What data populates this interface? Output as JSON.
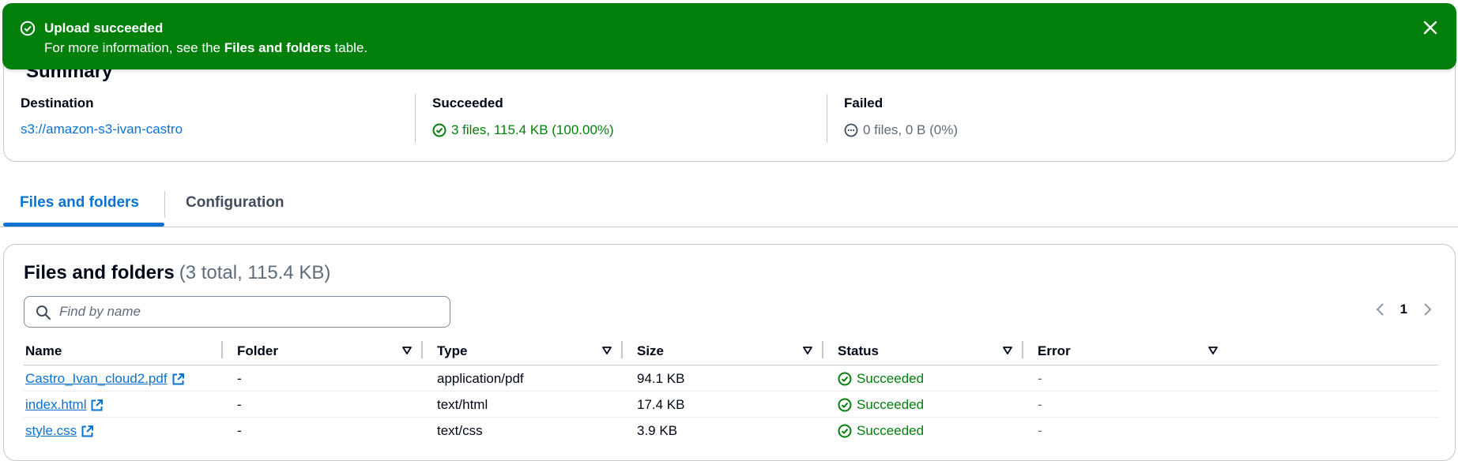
{
  "flash": {
    "title": "Upload succeeded",
    "message_prefix": "For more information, see the ",
    "message_bold": "Files and folders",
    "message_suffix": " table.",
    "color": "#037f0c"
  },
  "summary": {
    "title": "Summary",
    "destination": {
      "label": "Destination",
      "value": "s3://amazon-s3-ivan-castro"
    },
    "succeeded": {
      "label": "Succeeded",
      "value": "3 files, 115.4 KB (100.00%)"
    },
    "failed": {
      "label": "Failed",
      "value": "0 files, 0 B (0%)"
    }
  },
  "tabs": [
    {
      "label": "Files and folders",
      "active": true
    },
    {
      "label": "Configuration",
      "active": false
    }
  ],
  "files": {
    "title": "Files and folders",
    "count": "(3 total, 115.4 KB)",
    "search_placeholder": "Find by name",
    "page": "1",
    "columns": [
      "Name",
      "Folder",
      "Type",
      "Size",
      "Status",
      "Error"
    ],
    "rows": [
      {
        "name": "Castro_Ivan_cloud2.pdf",
        "folder": "-",
        "type": "application/pdf",
        "size": "94.1 KB",
        "status": "Succeeded",
        "error": "-"
      },
      {
        "name": "index.html",
        "folder": "-",
        "type": "text/html",
        "size": "17.4 KB",
        "status": "Succeeded",
        "error": "-"
      },
      {
        "name": "style.css",
        "folder": "-",
        "type": "text/css",
        "size": "3.9 KB",
        "status": "Succeeded",
        "error": "-"
      }
    ]
  },
  "icons": {
    "flash": "check-circle-icon",
    "close": "close-icon",
    "succeeded": "check-circle-icon",
    "failed": "pending-circle-icon",
    "search": "search-icon",
    "external": "external-link-icon",
    "sort": "caret-down-icon"
  }
}
